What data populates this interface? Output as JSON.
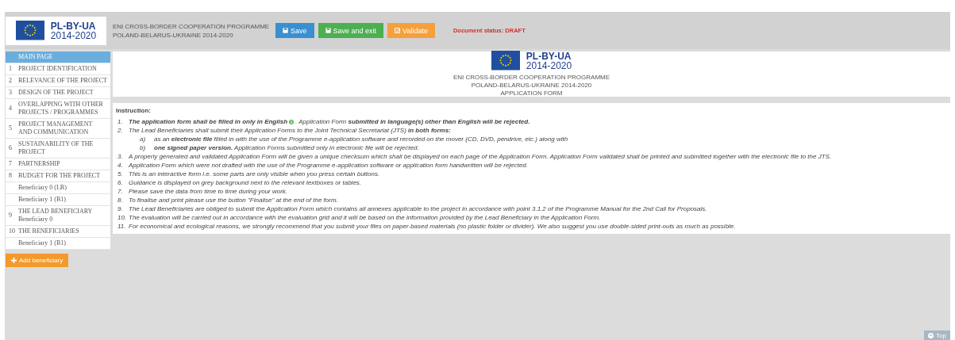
{
  "header": {
    "logo": {
      "name": "PL-BY-UA",
      "years": "2014-2020"
    },
    "programme_lines": [
      "ENI CROSS-BORDER COOPERATION PROGRAMME",
      "POLAND-BELARUS-UKRAINE 2014-2020"
    ],
    "buttons": [
      {
        "label": "Save",
        "kind": "save"
      },
      {
        "label": "Save and exit",
        "kind": "exit"
      },
      {
        "label": "Validate",
        "kind": "validate"
      }
    ],
    "document_status": "Document status: DRAFT"
  },
  "sidebar": {
    "items": [
      {
        "label": "MAIN PAGE",
        "selected": true
      },
      {
        "number": "1",
        "label": "PROJECT IDENTIFICATION",
        "selected": false
      },
      {
        "number": "2",
        "label": "RELEVANCE OF THE PROJECT",
        "selected": false
      },
      {
        "number": "3",
        "label": "DESIGN OF THE PROJECT",
        "selected": false
      },
      {
        "number": "4",
        "label": "OVERLAPPING WITH OTHER PROJECTS / PROGRAMMES",
        "selected": false
      },
      {
        "number": "5",
        "label": "PROJECT MANAGEMENT AND COMMUNICATION",
        "selected": false
      },
      {
        "number": "6",
        "label": "SUSTAINABILITY OF THE PROJECT",
        "selected": false
      },
      {
        "number": "7",
        "label": "PARTNERSHIP",
        "selected": false
      },
      {
        "number": "8",
        "label": "BUDGET FOR THE PROJECT",
        "selected": false,
        "children": [
          {
            "label": "Beneficiary 0 (LB)",
            "selected": false
          },
          {
            "label": "Beneficiary 1 (B1)",
            "selected": false
          }
        ]
      },
      {
        "number": "9",
        "label": "THE LEAD BENEFICIARY",
        "sublabel": "Beneficiary 0",
        "selected": false
      },
      {
        "number": "10",
        "label": "THE BENEFICIARIES",
        "selected": false,
        "children": [
          {
            "label": "Beneficiary 1 (B1)",
            "selected": false
          }
        ]
      }
    ],
    "add_button": "Add beneficiary"
  },
  "title_panel": {
    "logo": {
      "name": "PL-BY-UA",
      "years": "2014-2020"
    },
    "lines": [
      "ENI CROSS-BORDER COOPERATION PROGRAMME",
      "POLAND-BELARUS-UKRAINE 2014-2020",
      "APPLICATION FORM"
    ]
  },
  "instruction": {
    "heading": "Instruction:",
    "items": [
      {
        "number": "1.",
        "text": "**The application form shall be filled in only in English**",
        "text_after": ". Application Form **submitted in language(s) other than English will be rejected.**"
      },
      {
        "number": "2.",
        "text": "The Lead Beneficiaries shall submit their Application Forms to the Joint Technical Secretariat (JTS) **in both forms:**",
        "sub": [
          {
            "letter": "a)",
            "text": "as an **electronic file** filled in with the use of the Programme e-application software and recorded on the mover (CD, DVD, pendrive, etc.) along with"
          },
          {
            "letter": "b)",
            "text": "**one signed paper version.** Application Forms submitted only in electronic file will be rejected."
          }
        ]
      },
      {
        "number": "3.",
        "text": "A properly generated and validated Application Form will be given a unique checksum which shall be displayed on each page of the Application Form. Application Form validated shall be printed and submitted together with the electronic file to the JTS."
      },
      {
        "number": "4.",
        "text": "Application Form which were not drafted with the use of the Programme e-application software or application form handwritten will be rejected."
      },
      {
        "number": "5.",
        "text": "This is an interactive form i.e. some parts are only visible when you press certain buttons."
      },
      {
        "number": "6.",
        "text": "Guidance is displayed on grey background next to the relevant textboxes or tables."
      },
      {
        "number": "7.",
        "text": "Please save the data from time to time during your work."
      },
      {
        "number": "8.",
        "text": "To finalise and print please use the button \"Finalise\" at the end of the form."
      },
      {
        "number": "9.",
        "text": "The Lead Beneficiaries are obliged to submit the Application Form which contains all annexes applicable to the project in accordance with point 3.1.2 of the Programme Manual for the 2nd Call for Proposals."
      },
      {
        "number": "10.",
        "text": "The evaluation will be carried out in accordance with the evaluation grid and it will be based on the information provided by the Lead Beneficiary in the Application Form."
      },
      {
        "number": "11.",
        "text": "For economical and ecological reasons, we strongly recommend that you submit your files on paper-based materials (no plastic folder or divider). We also suggest you use double-sided print-outs as much as possible."
      }
    ]
  },
  "top_button": "Top"
}
